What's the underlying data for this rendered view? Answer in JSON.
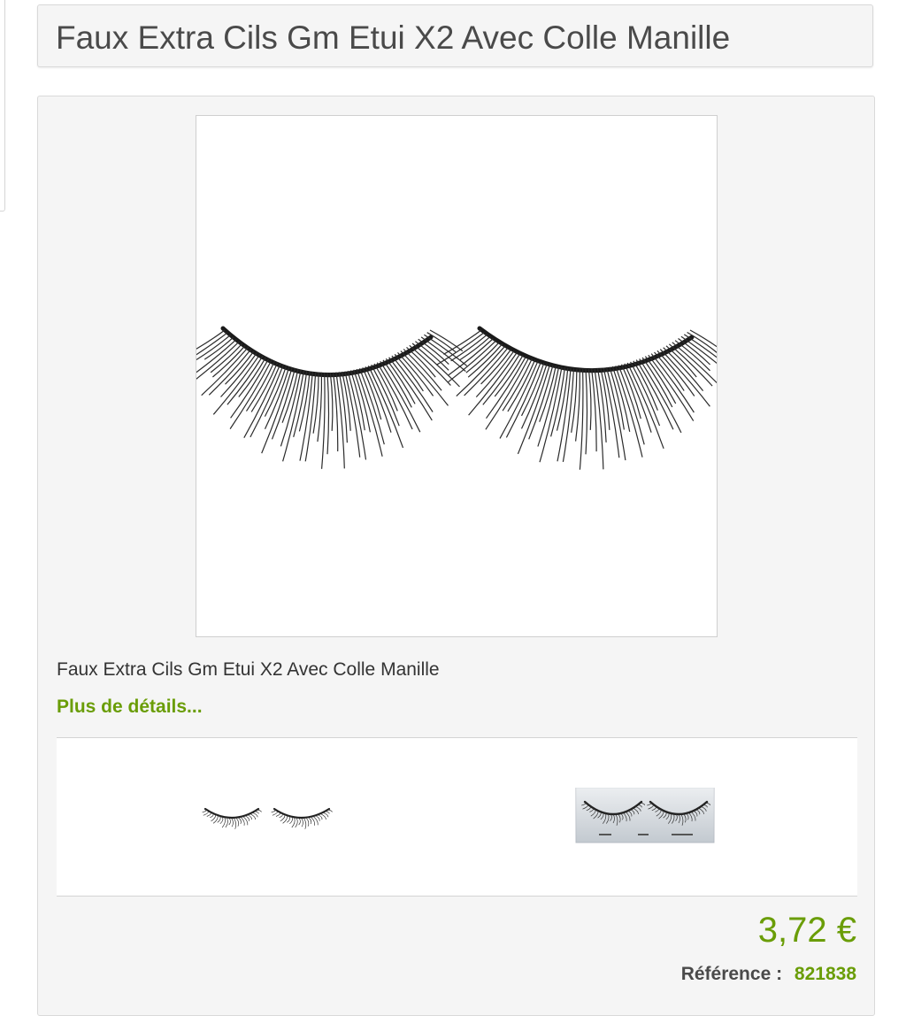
{
  "page": {
    "title": "Faux Extra Cils Gm Etui X2 Avec Colle Manille"
  },
  "product": {
    "name": "Faux Extra Cils Gm Etui X2 Avec Colle Manille",
    "details_link": "Plus de détails...",
    "price": "3,72 €",
    "reference_label": "Référence :",
    "reference_value": "821838",
    "main_image_icon": "false-eyelashes-pair",
    "thumbnails": [
      {
        "icon": "false-eyelashes-pair"
      },
      {
        "icon": "eyelashes-packaging"
      }
    ]
  },
  "colors": {
    "accent_green": "#6a9d07",
    "title_text": "#4a4a4a",
    "panel_bg": "#f5f5f5"
  }
}
